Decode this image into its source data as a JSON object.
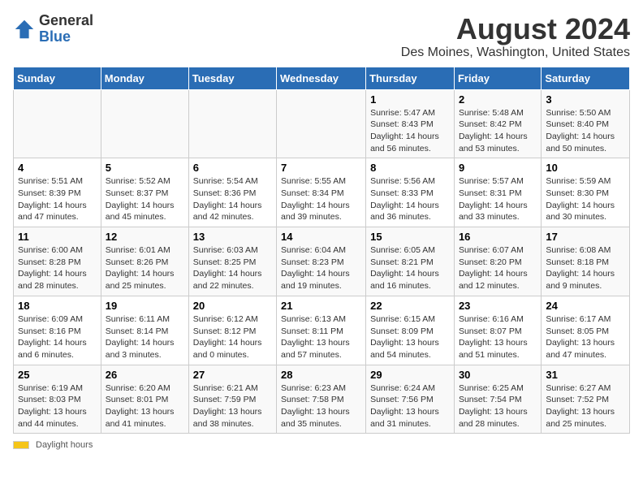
{
  "header": {
    "logo_general": "General",
    "logo_blue": "Blue",
    "title": "August 2024",
    "subtitle": "Des Moines, Washington, United States"
  },
  "weekdays": [
    "Sunday",
    "Monday",
    "Tuesday",
    "Wednesday",
    "Thursday",
    "Friday",
    "Saturday"
  ],
  "weeks": [
    [
      {
        "num": "",
        "detail": ""
      },
      {
        "num": "",
        "detail": ""
      },
      {
        "num": "",
        "detail": ""
      },
      {
        "num": "",
        "detail": ""
      },
      {
        "num": "1",
        "detail": "Sunrise: 5:47 AM\nSunset: 8:43 PM\nDaylight: 14 hours and 56 minutes."
      },
      {
        "num": "2",
        "detail": "Sunrise: 5:48 AM\nSunset: 8:42 PM\nDaylight: 14 hours and 53 minutes."
      },
      {
        "num": "3",
        "detail": "Sunrise: 5:50 AM\nSunset: 8:40 PM\nDaylight: 14 hours and 50 minutes."
      }
    ],
    [
      {
        "num": "4",
        "detail": "Sunrise: 5:51 AM\nSunset: 8:39 PM\nDaylight: 14 hours and 47 minutes."
      },
      {
        "num": "5",
        "detail": "Sunrise: 5:52 AM\nSunset: 8:37 PM\nDaylight: 14 hours and 45 minutes."
      },
      {
        "num": "6",
        "detail": "Sunrise: 5:54 AM\nSunset: 8:36 PM\nDaylight: 14 hours and 42 minutes."
      },
      {
        "num": "7",
        "detail": "Sunrise: 5:55 AM\nSunset: 8:34 PM\nDaylight: 14 hours and 39 minutes."
      },
      {
        "num": "8",
        "detail": "Sunrise: 5:56 AM\nSunset: 8:33 PM\nDaylight: 14 hours and 36 minutes."
      },
      {
        "num": "9",
        "detail": "Sunrise: 5:57 AM\nSunset: 8:31 PM\nDaylight: 14 hours and 33 minutes."
      },
      {
        "num": "10",
        "detail": "Sunrise: 5:59 AM\nSunset: 8:30 PM\nDaylight: 14 hours and 30 minutes."
      }
    ],
    [
      {
        "num": "11",
        "detail": "Sunrise: 6:00 AM\nSunset: 8:28 PM\nDaylight: 14 hours and 28 minutes."
      },
      {
        "num": "12",
        "detail": "Sunrise: 6:01 AM\nSunset: 8:26 PM\nDaylight: 14 hours and 25 minutes."
      },
      {
        "num": "13",
        "detail": "Sunrise: 6:03 AM\nSunset: 8:25 PM\nDaylight: 14 hours and 22 minutes."
      },
      {
        "num": "14",
        "detail": "Sunrise: 6:04 AM\nSunset: 8:23 PM\nDaylight: 14 hours and 19 minutes."
      },
      {
        "num": "15",
        "detail": "Sunrise: 6:05 AM\nSunset: 8:21 PM\nDaylight: 14 hours and 16 minutes."
      },
      {
        "num": "16",
        "detail": "Sunrise: 6:07 AM\nSunset: 8:20 PM\nDaylight: 14 hours and 12 minutes."
      },
      {
        "num": "17",
        "detail": "Sunrise: 6:08 AM\nSunset: 8:18 PM\nDaylight: 14 hours and 9 minutes."
      }
    ],
    [
      {
        "num": "18",
        "detail": "Sunrise: 6:09 AM\nSunset: 8:16 PM\nDaylight: 14 hours and 6 minutes."
      },
      {
        "num": "19",
        "detail": "Sunrise: 6:11 AM\nSunset: 8:14 PM\nDaylight: 14 hours and 3 minutes."
      },
      {
        "num": "20",
        "detail": "Sunrise: 6:12 AM\nSunset: 8:12 PM\nDaylight: 14 hours and 0 minutes."
      },
      {
        "num": "21",
        "detail": "Sunrise: 6:13 AM\nSunset: 8:11 PM\nDaylight: 13 hours and 57 minutes."
      },
      {
        "num": "22",
        "detail": "Sunrise: 6:15 AM\nSunset: 8:09 PM\nDaylight: 13 hours and 54 minutes."
      },
      {
        "num": "23",
        "detail": "Sunrise: 6:16 AM\nSunset: 8:07 PM\nDaylight: 13 hours and 51 minutes."
      },
      {
        "num": "24",
        "detail": "Sunrise: 6:17 AM\nSunset: 8:05 PM\nDaylight: 13 hours and 47 minutes."
      }
    ],
    [
      {
        "num": "25",
        "detail": "Sunrise: 6:19 AM\nSunset: 8:03 PM\nDaylight: 13 hours and 44 minutes."
      },
      {
        "num": "26",
        "detail": "Sunrise: 6:20 AM\nSunset: 8:01 PM\nDaylight: 13 hours and 41 minutes."
      },
      {
        "num": "27",
        "detail": "Sunrise: 6:21 AM\nSunset: 7:59 PM\nDaylight: 13 hours and 38 minutes."
      },
      {
        "num": "28",
        "detail": "Sunrise: 6:23 AM\nSunset: 7:58 PM\nDaylight: 13 hours and 35 minutes."
      },
      {
        "num": "29",
        "detail": "Sunrise: 6:24 AM\nSunset: 7:56 PM\nDaylight: 13 hours and 31 minutes."
      },
      {
        "num": "30",
        "detail": "Sunrise: 6:25 AM\nSunset: 7:54 PM\nDaylight: 13 hours and 28 minutes."
      },
      {
        "num": "31",
        "detail": "Sunrise: 6:27 AM\nSunset: 7:52 PM\nDaylight: 13 hours and 25 minutes."
      }
    ]
  ],
  "footer": {
    "daylight_label": "Daylight hours"
  }
}
